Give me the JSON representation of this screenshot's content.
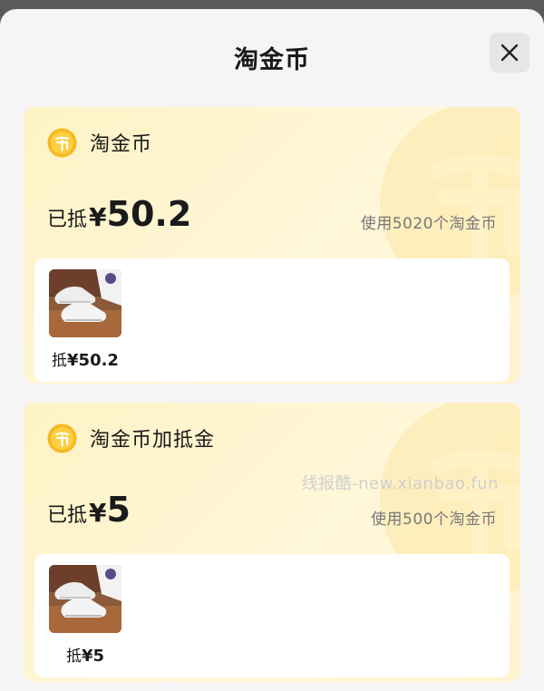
{
  "header": {
    "title": "淘金币",
    "close_icon": "close-icon"
  },
  "cards": [
    {
      "title": "淘金币",
      "deduct_label": "已抵",
      "currency": "¥",
      "amount": "50.2",
      "use_text": "使用5020个淘金币",
      "item": {
        "label": "抵",
        "currency": "¥",
        "price": "50.2",
        "image": "sneaker-thumbnail"
      }
    },
    {
      "title": "淘金币加抵金",
      "deduct_label": "已抵",
      "currency": "¥",
      "amount": "5",
      "use_text": "使用500个淘金币",
      "watermark": "线报酷-new.xianbao.fun",
      "item": {
        "label": "抵",
        "currency": "¥",
        "price": "5",
        "image": "sneaker-thumbnail"
      }
    }
  ],
  "colors": {
    "accent_coin": "#f5b820",
    "card_background": "#fdf3c6",
    "text_primary": "#1a1a1a",
    "text_secondary": "#777777"
  }
}
